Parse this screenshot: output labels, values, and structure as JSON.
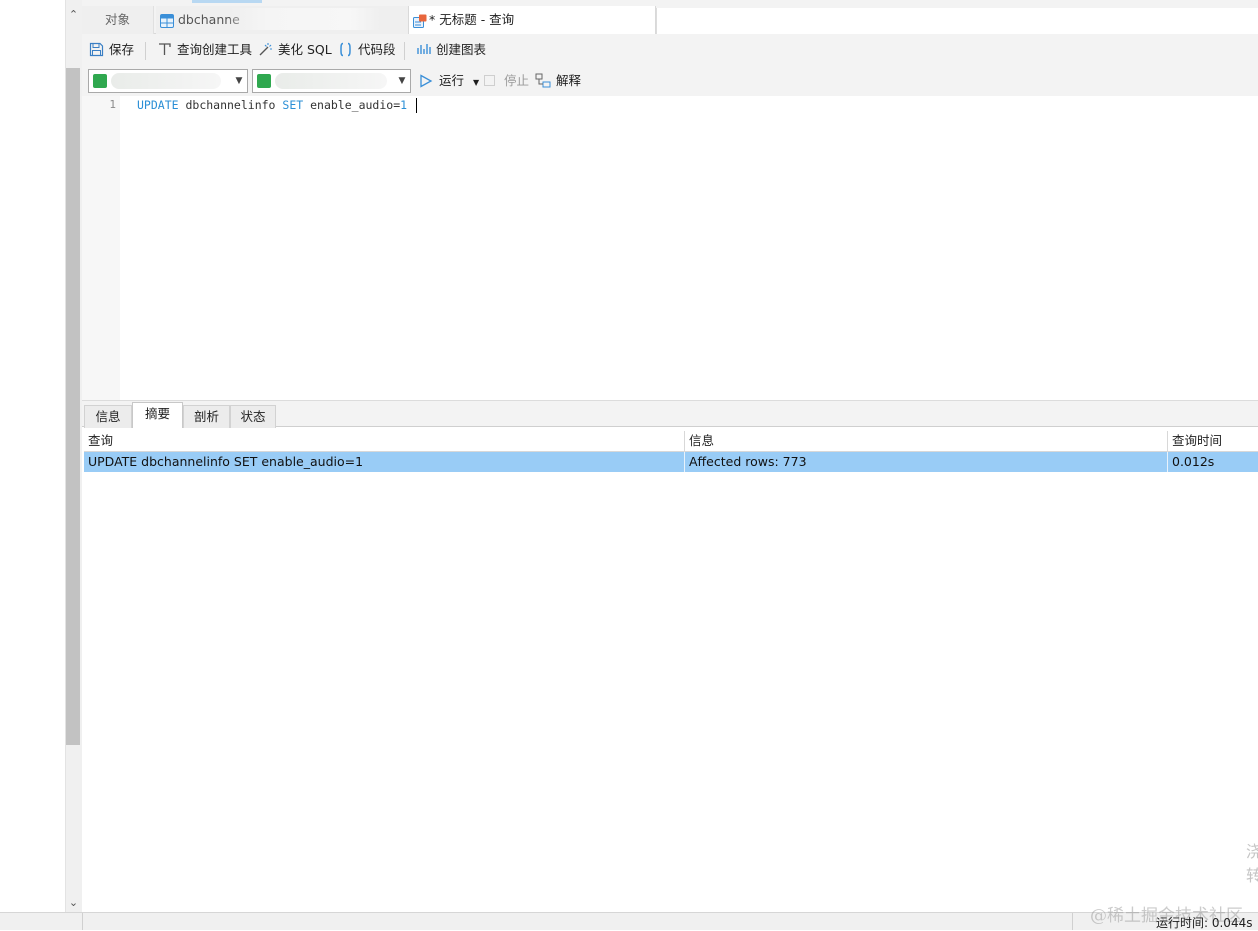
{
  "tabs": {
    "objects": "对象",
    "db_table": "dbchanne",
    "query": "* 无标题 - 查询"
  },
  "toolbar": {
    "save": "保存",
    "query_builder": "查询创建工具",
    "beautify_sql": "美化 SQL",
    "code_snippet": "代码段",
    "create_chart": "创建图表"
  },
  "run_bar": {
    "run": "运行",
    "stop": "停止",
    "explain": "解释"
  },
  "editor": {
    "line_number": "1",
    "kw_update": "UPDATE",
    "table": " dbchannelinfo ",
    "kw_set": "SET",
    "assignment": " enable_audio=",
    "value": "1"
  },
  "result_tabs": [
    "信息",
    "摘要",
    "剖析",
    "状态"
  ],
  "grid": {
    "columns": [
      "查询",
      "信息",
      "查询时间"
    ],
    "rows": [
      [
        "UPDATE dbchannelinfo SET enable_audio=1",
        "Affected rows: 773",
        "0.012s"
      ]
    ]
  },
  "status": {
    "runtime": "运行时间: 0.044s"
  },
  "watermark": "@稀土掘金技术社区",
  "colors": {
    "keyword": "#2b8fd6",
    "selected_row": "#99ccf6",
    "chrome": "#f3f3f3"
  }
}
